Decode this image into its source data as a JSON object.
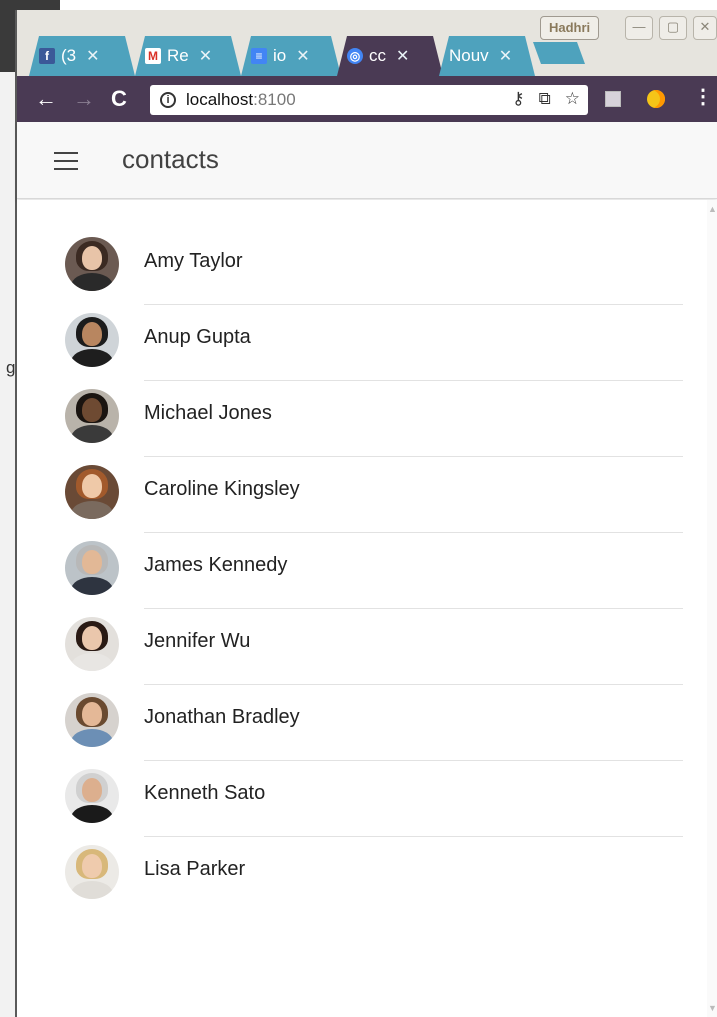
{
  "browser": {
    "tabs": [
      {
        "label": "(3",
        "favicon": "f",
        "favicon_color": "#3b5998",
        "active": false
      },
      {
        "label": "Re",
        "favicon": "M",
        "favicon_color": "#d93025",
        "active": false
      },
      {
        "label": "io",
        "favicon": "≡",
        "favicon_color": "#4285f4",
        "active": false
      },
      {
        "label": "cc",
        "favicon": "◎",
        "favicon_color": "#4285f4",
        "active": true
      },
      {
        "label": "Nouv",
        "favicon": "",
        "favicon_color": "",
        "active": false
      }
    ],
    "user_badge": "Hadhri",
    "url_host": "localhost",
    "url_port": ":8100",
    "colors": {
      "tab_inactive": "#4ea2bd",
      "toolbar": "#4a3a54",
      "titlebar": "#e6e4de"
    }
  },
  "app": {
    "title": "contacts",
    "contacts": [
      {
        "name": "Amy Taylor"
      },
      {
        "name": "Anup Gupta"
      },
      {
        "name": "Michael Jones"
      },
      {
        "name": "Caroline Kingsley"
      },
      {
        "name": "James Kennedy"
      },
      {
        "name": "Jennifer Wu"
      },
      {
        "name": "Jonathan Bradley"
      },
      {
        "name": "Kenneth Sato"
      },
      {
        "name": "Lisa Parker"
      }
    ]
  },
  "desktop": {
    "side_text": "g"
  }
}
